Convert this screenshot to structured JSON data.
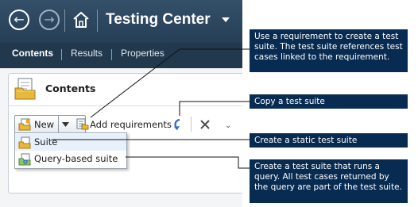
{
  "header": {
    "back_icon": "back-arrow-icon",
    "forward_icon": "forward-arrow-icon",
    "home_icon": "home-icon",
    "title": "Testing Center",
    "title_dropdown_icon": "chevron-down-icon"
  },
  "tabs": [
    {
      "label": "Contents",
      "active": true
    },
    {
      "label": "Results",
      "active": false
    },
    {
      "label": "Properties",
      "active": false
    }
  ],
  "panel": {
    "icon": "test-plan-folder-icon",
    "title": "Contents"
  },
  "toolbar": {
    "new_label": "New",
    "new_icon": "test-suite-icon",
    "add_requirements_label": "Add requirements",
    "add_requirements_icon": "requirements-icon",
    "copy_icon": "copy-suite-arrow-icon",
    "delete_icon": "delete-x-icon"
  },
  "new_menu": [
    {
      "label": "Suite",
      "icon": "static-suite-icon"
    },
    {
      "label": "Query-based suite",
      "icon": "query-suite-icon"
    }
  ],
  "callouts": [
    {
      "id": "requirement",
      "text": "Use a requirement to create a test suite. The test suite references test cases linked to the requirement."
    },
    {
      "id": "copy",
      "text": "Copy a test suite"
    },
    {
      "id": "static",
      "text": "Create a static test suite"
    },
    {
      "id": "query",
      "text": "Create a test suite that runs a query. All test cases returned by the query are part of the test suite."
    }
  ],
  "colors": {
    "titlebar": "#2d465e",
    "tabstrip": "#22384d",
    "callout_bg": "#082b52",
    "callout_text": "#ffffff"
  }
}
